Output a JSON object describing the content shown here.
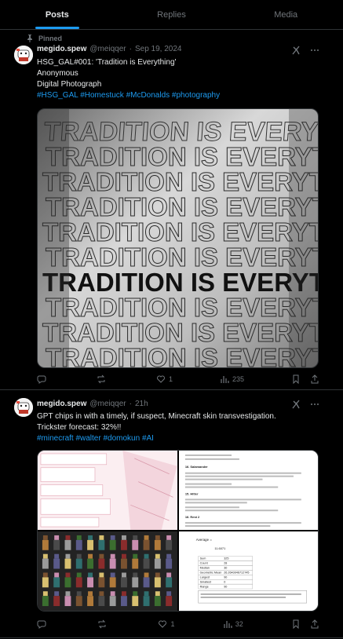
{
  "tabs": [
    "Posts",
    "Replies",
    "Media"
  ],
  "posts": [
    {
      "pinned_label": "Pinned",
      "name": "megido.spew",
      "handle": "@meiqqer",
      "sep": "·",
      "date": "Sep 19, 2024",
      "text_lines": [
        "HSG_GAL#001: 'Tradition is Everything'",
        "Anonymous",
        "Digital Photograph"
      ],
      "hashtags": "#HSG_GAL #Homestuck #McDonalds #photography",
      "image_text": "TRADITION IS EVERYTHING",
      "stats": {
        "replies": "",
        "reposts": "",
        "likes": "1",
        "views": "235"
      }
    },
    {
      "name": "megido.spew",
      "handle": "@meiqqer",
      "sep": "·",
      "date": "21h",
      "text_lines": [
        "GPT chips in with a timely, if suspect, Minecraft skin transvestigation.",
        "Trickster forecast: 32%!!"
      ],
      "hashtags": "#minecraft #walter #domokun #AI",
      "doc_heading_1": "16. Salamander",
      "doc_heading_2": "15. Hitler",
      "doc_heading_3": "16. Rest 2",
      "stats_labels": [
        "Sum",
        "Count",
        "Median",
        "Geometric Mean",
        "Largest",
        "Smallest",
        "Range"
      ],
      "stats_values": [
        "325",
        "28",
        "30",
        "26.2640046712745",
        "90",
        "0",
        "90"
      ],
      "average_label": "Average =",
      "average_value": "11.6071",
      "stats": {
        "replies": "",
        "reposts": "",
        "likes": "1",
        "views": "32"
      }
    }
  ],
  "colors": {
    "accent": "#1d9bf0",
    "muted": "#71767b",
    "text": "#e7e9ea",
    "border": "#2f3336"
  }
}
